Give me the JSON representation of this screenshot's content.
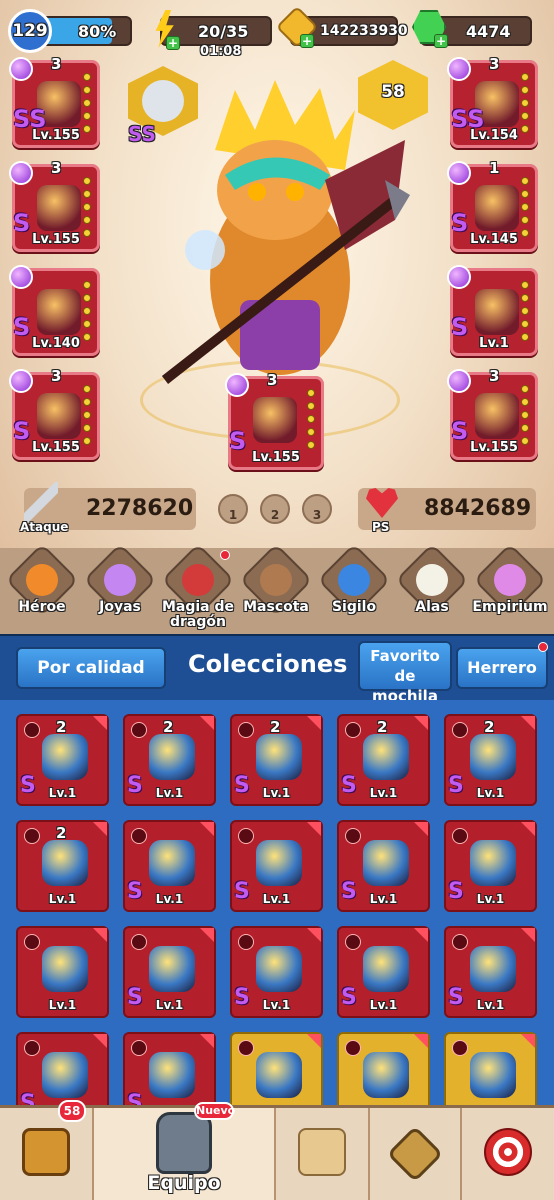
{
  "header": {
    "level": "129",
    "xp_percent": "80%",
    "xp_fraction": 0.8,
    "energy": "20/35",
    "energy_timer": "01:08",
    "gold": "142233930",
    "gems": "4474"
  },
  "hero": {
    "pet_level": "58"
  },
  "left_slots": [
    {
      "count": "3",
      "grade": "SS",
      "level": "Lv.155"
    },
    {
      "count": "3",
      "grade": "S",
      "level": "Lv.155"
    },
    {
      "count": "",
      "grade": "S",
      "level": "Lv.140"
    },
    {
      "count": "3",
      "grade": "S",
      "level": "Lv.155"
    }
  ],
  "right_slots": [
    {
      "count": "3",
      "grade": "SS",
      "level": "Lv.154"
    },
    {
      "count": "1",
      "grade": "S",
      "level": "Lv.145"
    },
    {
      "count": "",
      "grade": "S",
      "level": "Lv.1"
    },
    {
      "count": "3",
      "grade": "S",
      "level": "Lv.155"
    }
  ],
  "center_slot": {
    "count": "3",
    "grade": "S",
    "level": "Lv.155"
  },
  "hero_shield_grade": "SS",
  "stats": {
    "attack_label": "Ataque",
    "attack_value": "2278620",
    "hp_label": "PS",
    "hp_value": "8842689",
    "presets": [
      "1",
      "2",
      "3"
    ]
  },
  "categories": [
    {
      "label": "Héroe",
      "color": "#f08a2a"
    },
    {
      "label": "Joyas",
      "color": "#c486f0"
    },
    {
      "label": "Magia de dragón",
      "color": "#d33a3a"
    },
    {
      "label": "Mascota",
      "color": "#b07a50"
    },
    {
      "label": "Sigilo",
      "color": "#3a86e0"
    },
    {
      "label": "Alas",
      "color": "#f4f1e6"
    },
    {
      "label": "Empirium",
      "color": "#e08ae8"
    }
  ],
  "collections": {
    "sort_button": "Por calidad",
    "title": "Colecciones",
    "favorites_button": "Favorito de mochila",
    "smith_button": "Herrero"
  },
  "grid": [
    [
      {
        "count": "2",
        "grade": "S",
        "level": "Lv.1",
        "bg": "red"
      },
      {
        "count": "2",
        "grade": "S",
        "level": "Lv.1",
        "bg": "red"
      },
      {
        "count": "2",
        "grade": "S",
        "level": "Lv.1",
        "bg": "red"
      },
      {
        "count": "2",
        "grade": "S",
        "level": "Lv.1",
        "bg": "red"
      },
      {
        "count": "2",
        "grade": "S",
        "level": "Lv.1",
        "bg": "red"
      }
    ],
    [
      {
        "count": "2",
        "grade": "",
        "level": "Lv.1",
        "bg": "red"
      },
      {
        "count": "",
        "grade": "S",
        "level": "Lv.1",
        "bg": "red"
      },
      {
        "count": "",
        "grade": "S",
        "level": "Lv.1",
        "bg": "red"
      },
      {
        "count": "",
        "grade": "S",
        "level": "Lv.1",
        "bg": "red"
      },
      {
        "count": "",
        "grade": "S",
        "level": "Lv.1",
        "bg": "red"
      }
    ],
    [
      {
        "count": "",
        "grade": "",
        "level": "Lv.1",
        "bg": "red"
      },
      {
        "count": "",
        "grade": "S",
        "level": "Lv.1",
        "bg": "red"
      },
      {
        "count": "",
        "grade": "S",
        "level": "Lv.1",
        "bg": "red"
      },
      {
        "count": "",
        "grade": "S",
        "level": "Lv.1",
        "bg": "red"
      },
      {
        "count": "",
        "grade": "S",
        "level": "Lv.1",
        "bg": "red"
      }
    ],
    [
      {
        "count": "",
        "grade": "S",
        "level": "",
        "bg": "red"
      },
      {
        "count": "",
        "grade": "S",
        "level": "",
        "bg": "red"
      },
      {
        "count": "",
        "grade": "",
        "level": "",
        "bg": "gold"
      },
      {
        "count": "",
        "grade": "",
        "level": "",
        "bg": "gold"
      },
      {
        "count": "",
        "grade": "",
        "level": "",
        "bg": "gold"
      }
    ]
  ],
  "nav": {
    "chest_badge": "58",
    "equip_label": "Equipo",
    "equip_badge": "Nuevo"
  }
}
